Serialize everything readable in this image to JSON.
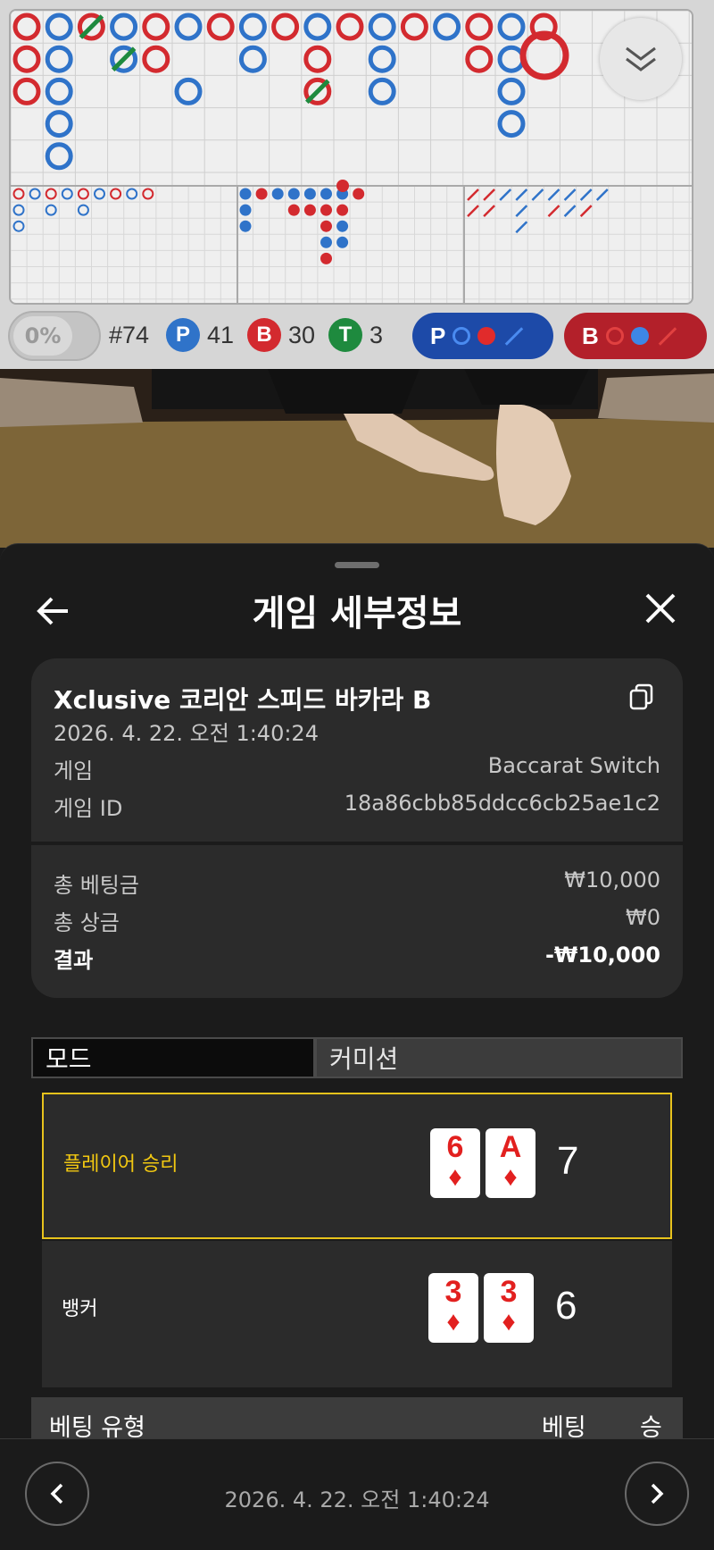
{
  "roadmap": {
    "round_number": "#74",
    "percent": "0%",
    "player": {
      "letter": "P",
      "count": "41",
      "color": "#2f73c9"
    },
    "banker": {
      "letter": "B",
      "count": "30",
      "color": "#d32a2f"
    },
    "tie": {
      "letter": "T",
      "count": "3",
      "color": "#1e8a3e"
    },
    "predict_player": {
      "letter": "P"
    },
    "predict_banker": {
      "letter": "B"
    }
  },
  "sheet": {
    "title": "게임 세부정보",
    "game_name": "Xclusive 코리안 스피드 바카라 B",
    "datetime": "2026. 4. 22. 오전 1:40:24",
    "game_label": "게임",
    "game_value": "Baccarat Switch",
    "game_id_label": "게임 ID",
    "game_id_value": "18a86cbb85ddcc6cb25ae1c2",
    "total_bet_label": "총 베팅금",
    "total_bet_value": "₩10,000",
    "total_win_label": "총 상금",
    "total_win_value": "₩0",
    "result_label": "결과",
    "result_value": "-₩10,000"
  },
  "tabs": {
    "mode": "모드",
    "commission": "커미션"
  },
  "hands": {
    "player": {
      "label": "플레이어 승리",
      "cards": [
        {
          "rank": "6",
          "suit": "♦"
        },
        {
          "rank": "A",
          "suit": "♦"
        }
      ],
      "total": "7",
      "label_color": "#f2c811"
    },
    "banker": {
      "label": "뱅커",
      "cards": [
        {
          "rank": "3",
          "suit": "♦"
        },
        {
          "rank": "3",
          "suit": "♦"
        }
      ],
      "total": "6",
      "label_color": "#ffffff"
    }
  },
  "bet_table": {
    "type_header": "베팅 유형",
    "bet_header": "베팅",
    "win_header": "승"
  },
  "footer": {
    "datetime": "2026. 4. 22. 오전 1:40:24"
  }
}
